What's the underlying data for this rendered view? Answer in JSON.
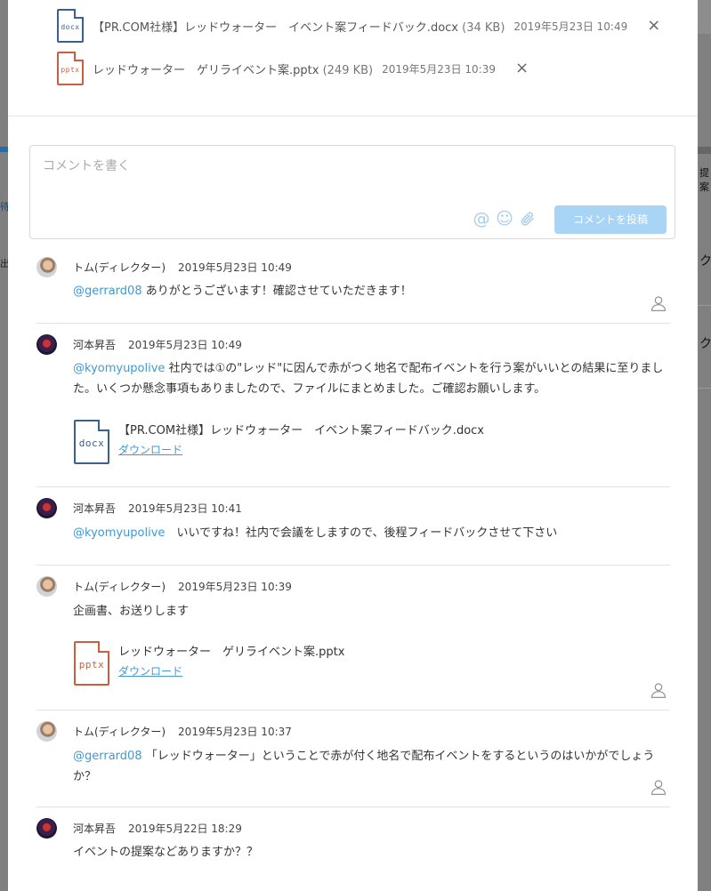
{
  "background": {
    "left_texts": [
      "待",
      "出"
    ],
    "right_texts": [
      "提案",
      "ク",
      "ク"
    ]
  },
  "attachments": [
    {
      "type": "docx",
      "icon": "docx-file-icon",
      "name": "【PR.COM社様】レッドウォーター　イベント案フィードバック.docx",
      "size": "(34 KB)",
      "date": "2019年5月23日 10:49",
      "close": "×"
    },
    {
      "type": "pptx",
      "icon": "pptx-file-icon",
      "name": "レッドウォーター　ゲリライベント案.pptx",
      "size": "(249 KB)",
      "date": "2019年5月23日 10:39",
      "close": "×"
    }
  ],
  "comment_form": {
    "placeholder": "コメントを書く",
    "value": "",
    "mention_icon": "@",
    "emoji_icon": "☺",
    "submit_label": "コメントを投稿",
    "accent": "#a8d4f5"
  },
  "comments": [
    {
      "author": "トム(ディレクター)",
      "time": "2019年5月23日 10:49",
      "mention": "@gerrard08",
      "text": " ありがとうございます！確認させていただきます！",
      "avatar": "tom"
    },
    {
      "author": "河本昇吾",
      "time": "2019年5月23日 10:49",
      "mention": "@kyomyupolive",
      "text": " 社内では①の\"レッド\"に因んで赤がつく地名で配布イベントを行う案がいいとの結果に至りました。いくつか懸念事項もありましたので、ファイルにまとめました。ご確認お願いします。",
      "file": {
        "ext": "docx",
        "name": "【PR.COM社様】レッドウォーター　イベント案フィードバック.docx",
        "download": "ダウンロード"
      },
      "avatar": "kawamoto"
    },
    {
      "author": "河本昇吾",
      "time": "2019年5月23日 10:41",
      "mention": "@kyomyupolive",
      "text": "　いいですね！社内で会議をしますので、後程フィードバックさせて下さい",
      "avatar": "kawamoto"
    },
    {
      "author": "トム(ディレクター)",
      "time": "2019年5月23日 10:39",
      "mention": "",
      "text": "企画書、お送りします",
      "file": {
        "ext": "pptx",
        "name": "レッドウォーター　ゲリライベント案.pptx",
        "download": "ダウンロード"
      },
      "avatar": "tom"
    },
    {
      "author": "トム(ディレクター)",
      "time": "2019年5月23日 10:37",
      "mention": "@gerrard08",
      "text": " 「レッドウォーター」ということで赤が付く地名で配布イベントをするというのはいかがでしょうか？",
      "avatar": "tom"
    },
    {
      "author": "河本昇吾",
      "time": "2019年5月22日 18:29",
      "mention": "",
      "text": "イベントの提案などありますか？？",
      "avatar": "kawamoto"
    }
  ],
  "colors": {
    "link": "#3e9ad6",
    "docx": "#3b5f8f",
    "pptx": "#c8603f"
  }
}
